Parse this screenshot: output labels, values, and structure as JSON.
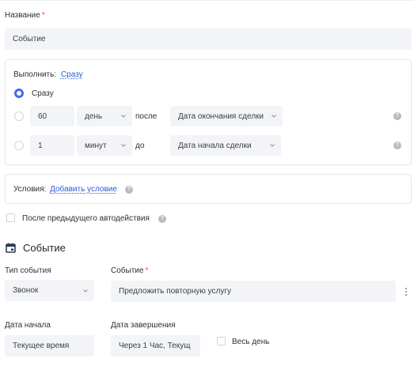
{
  "name_field": {
    "label": "Название",
    "required": "*",
    "value": "Событие"
  },
  "execute_card": {
    "label": "Выполнить:",
    "link": "Сразу",
    "option_immediately": "Сразу",
    "row1": {
      "amount": "60",
      "unit": "день",
      "relation": "после",
      "target": "Дата окончания сделки"
    },
    "row2": {
      "amount": "1",
      "unit": "минут",
      "relation": "до",
      "target": "Дата начала сделки"
    }
  },
  "conditions": {
    "label": "Условия:",
    "link": "Добавить условие"
  },
  "after_previous": {
    "label": "После предыдущего автодействия"
  },
  "section": {
    "title": "Событие",
    "icon": "calendar-icon"
  },
  "event_type": {
    "label": "Тип события",
    "value": "Звонок"
  },
  "event": {
    "label": "Событие",
    "required": "*",
    "value": "Предложить повторную услугу"
  },
  "start_date": {
    "label": "Дата начала",
    "value": "Текущее время"
  },
  "end_date": {
    "label": "Дата завершения",
    "value": "Через 1 Час, Текущ"
  },
  "all_day": {
    "label": "Весь день"
  },
  "colors": {
    "accent": "#3f6ee8",
    "link": "#2d5bd3",
    "required": "#e5484d",
    "field_bg": "#f2f4f7"
  }
}
